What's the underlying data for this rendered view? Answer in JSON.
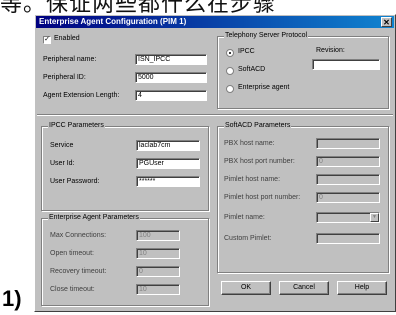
{
  "banner_text": "等。保证两些都什么在步骤",
  "step_number": "1)",
  "dialog": {
    "title": "Enterprise Agent Configuration (PIM 1)",
    "close_glyph": "✕"
  },
  "agent": {
    "enabled_label": "Enabled",
    "enabled_checked": true,
    "peripheral_name_label": "Peripheral name:",
    "peripheral_name_value": "ISN_IPCC",
    "peripheral_id_label": "Peripheral ID:",
    "peripheral_id_value": "5000",
    "extension_length_label": "Agent Extension Length:",
    "extension_length_value": "4"
  },
  "telephony": {
    "group_label": "Telephony Server Protocol",
    "options": [
      "IPCC",
      "SoftACD",
      "Enterprise agent"
    ],
    "selected": "IPCC",
    "revision_label": "Revision:",
    "revision_value": ""
  },
  "ipcc_params": {
    "group_label": "IPCC Parameters",
    "service_label": "Service",
    "service_value": "laclab7cm",
    "user_id_label": "User Id:",
    "user_id_value": "PGUser",
    "password_label": "User Password:",
    "password_value": "******"
  },
  "enterprise_params": {
    "group_label": "Enterprise Agent Parameters",
    "max_connections_label": "Max Connections:",
    "max_connections_value": "100",
    "open_timeout_label": "Open timeout:",
    "open_timeout_value": "10",
    "recovery_timeout_label": "Recovery timeout:",
    "recovery_timeout_value": "0",
    "close_timeout_label": "Close timeout:",
    "close_timeout_value": "10"
  },
  "softacd_params": {
    "group_label": "SoftACD Parameters",
    "pbx_host_name_label": "PBX host name:",
    "pbx_host_name_value": "",
    "pbx_host_port_label": "PBX host port number:",
    "pbx_host_port_value": "0",
    "pimlet_host_name_label": "Pimlet host name:",
    "pimlet_host_name_value": "",
    "pimlet_host_port_label": "Pimlet host port number:",
    "pimlet_host_port_value": "0",
    "pimlet_name_label": "Pimlet name:",
    "pimlet_name_value": "",
    "custom_pimlet_label": "Custom Pimlet:",
    "custom_pimlet_value": ""
  },
  "buttons": {
    "ok": "OK",
    "cancel": "Cancel",
    "help": "Help"
  }
}
